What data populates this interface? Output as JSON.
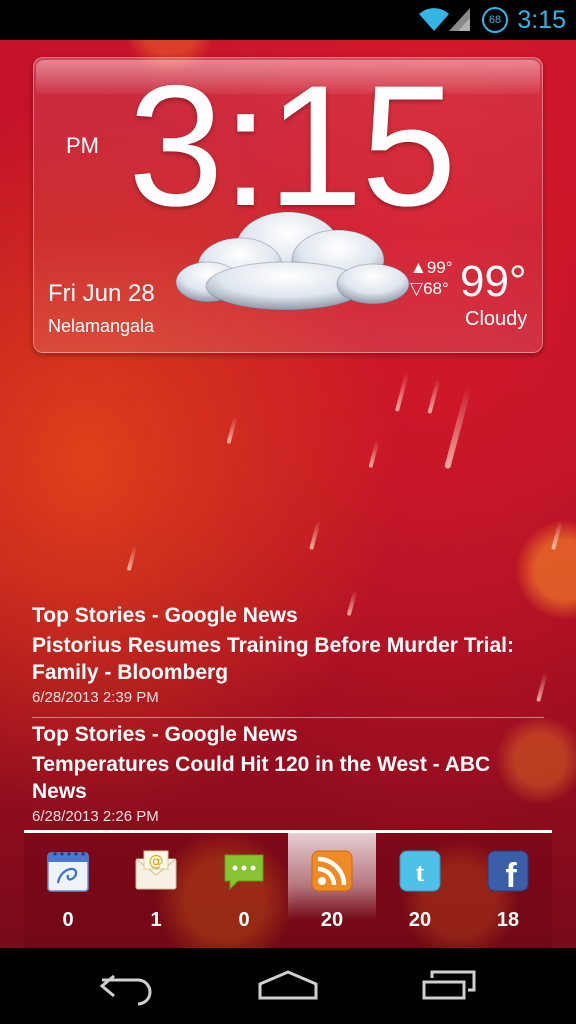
{
  "status_bar": {
    "time": "3:15",
    "battery_level": "68",
    "icons": [
      "wifi-icon",
      "signal-icon",
      "battery-icon"
    ],
    "accent_color": "#33b5e5"
  },
  "clock_widget": {
    "ampm": "PM",
    "time": "3:15",
    "date": "Fri Jun 28",
    "location": "Nelamangala",
    "high": "▲99°",
    "low": "▽68°",
    "current_temp": "99°",
    "condition": "Cloudy",
    "weather_icon": "cloud-icon"
  },
  "news": [
    {
      "source": "Top Stories - Google News",
      "title": "Pistorius Resumes Training Before Murder Trial: Family - Bloomberg",
      "date": "6/28/2013 2:39 PM"
    },
    {
      "source": "Top Stories - Google News",
      "title": "Temperatures Could Hit 120 in the West - ABC News",
      "date": "6/28/2013 2:26 PM"
    }
  ],
  "counters": [
    {
      "icon": "calendar-icon",
      "count": "0"
    },
    {
      "icon": "email-icon",
      "count": "1"
    },
    {
      "icon": "sms-icon",
      "count": "0"
    },
    {
      "icon": "rss-icon",
      "count": "20",
      "active": true
    },
    {
      "icon": "twitter-icon",
      "count": "20"
    },
    {
      "icon": "facebook-icon",
      "count": "18"
    }
  ],
  "nav_bar": {
    "buttons": [
      "back-icon",
      "home-icon",
      "recents-icon"
    ]
  }
}
